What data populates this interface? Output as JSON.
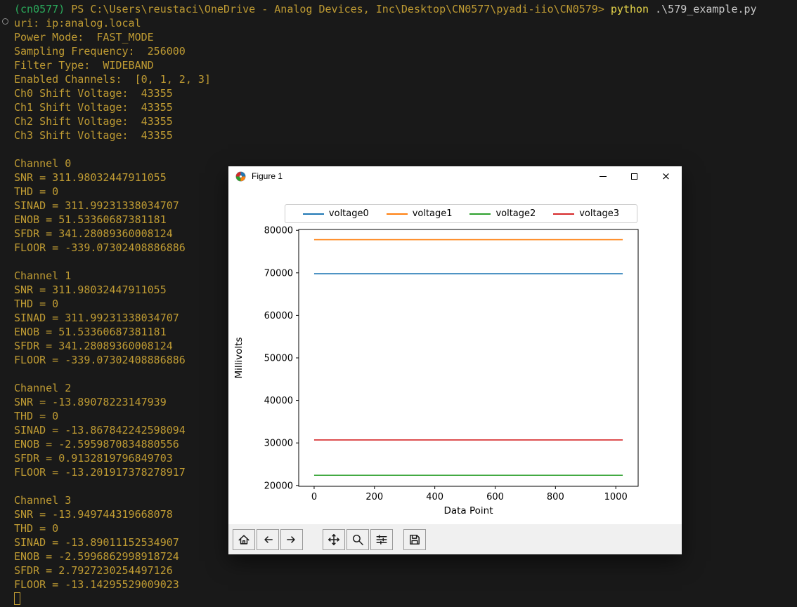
{
  "colors": {
    "terminal_bg": "#191919",
    "terminal_fg": "#bf9b33",
    "prompt_env_green": "#2bab5c",
    "command_yellow": "#e5d44a",
    "argument_gray": "#c9c9c9",
    "window_bg": "#ffffff",
    "toolbar_bg": "#f0f0f0"
  },
  "terminal": {
    "prompt": {
      "venv": "(cn0577)",
      "context": "PS C:\\Users\\reustaci\\OneDrive - Analog Devices, Inc\\Desktop\\CN0577\\pyadi-iio\\CN0579>",
      "command": "python",
      "argument": ".\\579_example.py"
    },
    "lines": [
      "uri: ip:analog.local",
      "Power Mode:  FAST_MODE",
      "Sampling Frequency:  256000",
      "Filter Type:  WIDEBAND",
      "Enabled Channels:  [0, 1, 2, 3]",
      "Ch0 Shift Voltage:  43355",
      "Ch1 Shift Voltage:  43355",
      "Ch2 Shift Voltage:  43355",
      "Ch3 Shift Voltage:  43355",
      "",
      "Channel 0",
      "SNR = 311.98032447911055",
      "THD = 0",
      "SINAD = 311.99231338034707",
      "ENOB = 51.53360687381181",
      "SFDR = 341.28089360008124",
      "FLOOR = -339.07302408886886",
      "",
      "Channel 1",
      "SNR = 311.98032447911055",
      "THD = 0",
      "SINAD = 311.99231338034707",
      "ENOB = 51.53360687381181",
      "SFDR = 341.28089360008124",
      "FLOOR = -339.07302408886886",
      "",
      "Channel 2",
      "SNR = -13.89078223147939",
      "THD = 0",
      "SINAD = -13.867842242598094",
      "ENOB = -2.5959870834880556",
      "SFDR = 0.9132819796849703",
      "FLOOR = -13.201917378278917",
      "",
      "Channel 3",
      "SNR = -13.949744319668078",
      "THD = 0",
      "SINAD = -13.89011152534907",
      "ENOB = -2.5996862998918724",
      "SFDR = 2.7927230254497126",
      "FLOOR = -13.14295529009023"
    ],
    "cursor_visible": true
  },
  "figure_window": {
    "title": "Figure 1",
    "window_controls": [
      "minimize",
      "maximize",
      "close"
    ],
    "toolbar": {
      "icons": [
        "home",
        "back",
        "forward",
        "pan",
        "zoom",
        "configure-subplots",
        "save"
      ]
    }
  },
  "chart_data": {
    "type": "line",
    "title": "",
    "xlabel": "Data Point",
    "ylabel": "Millivolts",
    "xlim": [
      -51.15,
      1074.15
    ],
    "ylim": [
      19800,
      80200
    ],
    "xticks": [
      0,
      200,
      400,
      600,
      800,
      1000
    ],
    "yticks": [
      20000,
      30000,
      40000,
      50000,
      60000,
      70000,
      80000
    ],
    "x_range": [
      0,
      1023
    ],
    "grid": false,
    "legend_position": "upper center, horizontal, outside axes",
    "series": [
      {
        "name": "voltage0",
        "color": "#1f77b4",
        "flat": true,
        "value": 69800
      },
      {
        "name": "voltage1",
        "color": "#ff7f0e",
        "flat": true,
        "value": 77800
      },
      {
        "name": "voltage2",
        "color": "#2ca02c",
        "flat": true,
        "value": 22400
      },
      {
        "name": "voltage3",
        "color": "#d62728",
        "flat": true,
        "value": 30700
      }
    ]
  }
}
